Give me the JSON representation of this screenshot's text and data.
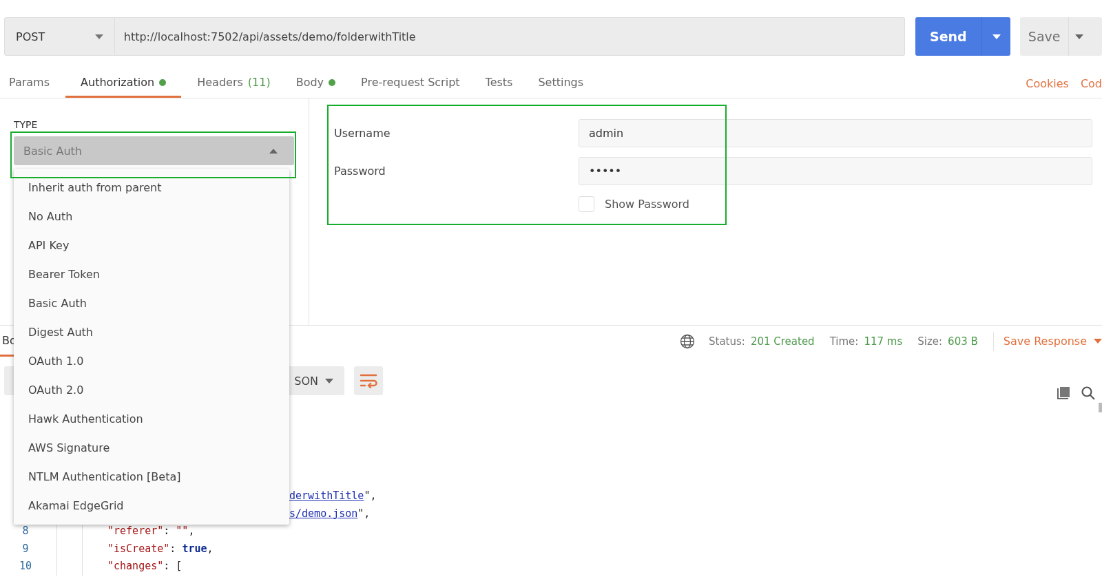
{
  "request": {
    "method": "POST",
    "url": "http://localhost:7502/api/assets/demo/folderwithTitle",
    "send": "Send",
    "save": "Save"
  },
  "tabs": [
    {
      "label": "Params",
      "dot": false,
      "selected": false
    },
    {
      "label": "Authorization",
      "dot": true,
      "selected": true
    },
    {
      "label": "Headers",
      "count": "(11)",
      "dot": false,
      "selected": false
    },
    {
      "label": "Body",
      "dot": true,
      "selected": false
    },
    {
      "label": "Pre-request Script",
      "dot": false,
      "selected": false
    },
    {
      "label": "Tests",
      "dot": false,
      "selected": false
    },
    {
      "label": "Settings",
      "dot": false,
      "selected": false
    }
  ],
  "links": [
    "Cookies",
    "Cod"
  ],
  "auth": {
    "type_label": "TYPE",
    "selected_type": "Basic Auth",
    "options": [
      "Inherit auth from parent",
      "No Auth",
      "API Key",
      "Bearer Token",
      "Basic Auth",
      "Digest Auth",
      "OAuth 1.0",
      "OAuth 2.0",
      "Hawk Authentication",
      "AWS Signature",
      "NTLM Authentication [Beta]",
      "Akamai EdgeGrid"
    ],
    "fields": [
      {
        "label": "Username",
        "value": "admin"
      },
      {
        "label": "Password",
        "value": "•••••"
      }
    ],
    "show_password": {
      "label": "Show Password",
      "checked": false
    }
  },
  "response": {
    "tab": "Bo",
    "status_label": "Status:",
    "status": "201 Created",
    "time_label": "Time:",
    "time": "117 ms",
    "size_label": "Size:",
    "size": "603 B",
    "save": "Save Response",
    "format": "SON",
    "lines": [
      {
        "segments": [
          {
            "kind": "link",
            "text": "derwithTitle"
          },
          {
            "kind": "punct",
            "text": "\","
          }
        ]
      },
      {
        "segments": [
          {
            "kind": "link",
            "text": "s/demo.json"
          },
          {
            "kind": "punct",
            "text": "\","
          }
        ]
      },
      {
        "number": "8",
        "segments": [
          {
            "kind": "key",
            "text": "\"referer\""
          },
          {
            "kind": "punct",
            "text": ": "
          },
          {
            "kind": "key",
            "text": "\"\""
          },
          {
            "kind": "punct",
            "text": ","
          }
        ]
      },
      {
        "number": "9",
        "segments": [
          {
            "kind": "key",
            "text": "\"isCreate\""
          },
          {
            "kind": "punct",
            "text": ": "
          },
          {
            "kind": "bool",
            "text": "true"
          },
          {
            "kind": "punct",
            "text": ","
          }
        ]
      },
      {
        "number": "10",
        "segments": [
          {
            "kind": "key",
            "text": "\"changes\""
          },
          {
            "kind": "punct",
            "text": ": ["
          }
        ]
      }
    ]
  }
}
